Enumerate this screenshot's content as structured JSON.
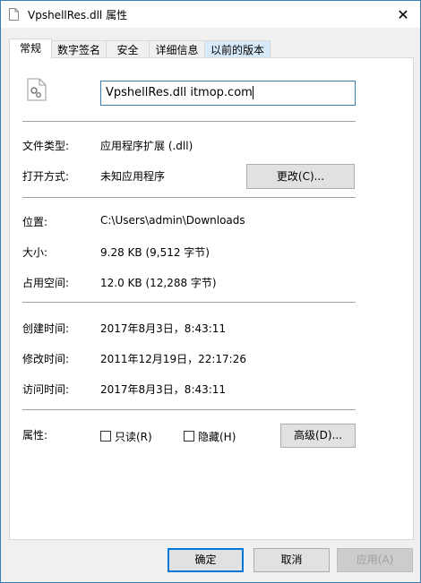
{
  "window": {
    "title": "VpshellRes.dll 属性",
    "close_label": "✕"
  },
  "tabs": [
    {
      "label": "常规"
    },
    {
      "label": "数字签名"
    },
    {
      "label": "安全"
    },
    {
      "label": "详细信息"
    },
    {
      "label": "以前的版本"
    }
  ],
  "general": {
    "filename": "VpshellRes.dll      itmop.com",
    "file_type_label": "文件类型:",
    "file_type_value": "应用程序扩展 (.dll)",
    "opens_with_label": "打开方式:",
    "opens_with_value": "未知应用程序",
    "change_button": "更改(C)...",
    "location_label": "位置:",
    "location_value": "C:\\Users\\admin\\Downloads",
    "size_label": "大小:",
    "size_value": "9.28 KB (9,512 字节)",
    "size_on_disk_label": "占用空间:",
    "size_on_disk_value": "12.0 KB (12,288 字节)",
    "created_label": "创建时间:",
    "created_value": "2017年8月3日，8:43:11",
    "modified_label": "修改时间:",
    "modified_value": "2011年12月19日，22:17:26",
    "accessed_label": "访问时间:",
    "accessed_value": "2017年8月3日，8:43:11",
    "attributes_label": "属性:",
    "readonly_label": "只读(R)",
    "hidden_label": "隐藏(H)",
    "advanced_button": "高级(D)..."
  },
  "footer": {
    "ok": "确定",
    "cancel": "取消",
    "apply": "应用(A)"
  },
  "colors": {
    "accent": "#0078d7",
    "window_border": "#3c7fb1",
    "tab_highlight": "#d8eaf9"
  }
}
